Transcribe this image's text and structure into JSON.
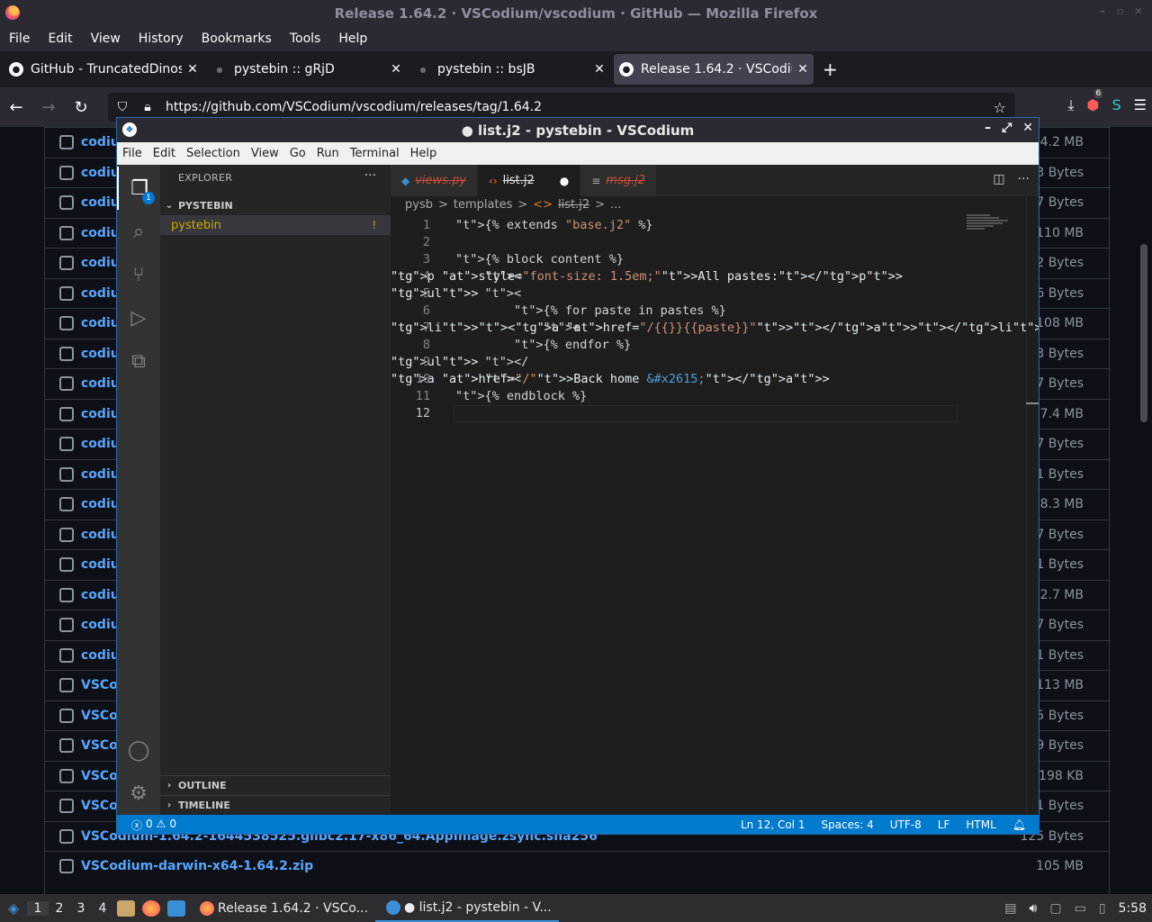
{
  "firefox": {
    "title": "Release 1.64.2 · VSCodium/vscodium · GitHub — Mozilla Firefox",
    "menu": [
      "File",
      "Edit",
      "View",
      "History",
      "Bookmarks",
      "Tools",
      "Help"
    ],
    "tabs": [
      {
        "label": "GitHub - TruncatedDinos",
        "icon": "github-icon"
      },
      {
        "label": "pystebin :: gRjD",
        "icon": "dot-icon"
      },
      {
        "label": "pystebin :: bsJB",
        "icon": "dot-icon"
      },
      {
        "label": "Release 1.64.2 · VSCodiu",
        "icon": "github-icon"
      }
    ],
    "url": "https://github.com/VSCodium/vscodium/releases/tag/1.64.2",
    "extension_badge": "6"
  },
  "assets": [
    {
      "name": "codiu",
      "size": "4.2 MB"
    },
    {
      "name": "codiu",
      "size": "3 Bytes"
    },
    {
      "name": "codiu",
      "size": "7 Bytes"
    },
    {
      "name": "codiu",
      "size": "110 MB"
    },
    {
      "name": "codiu",
      "size": "2 Bytes"
    },
    {
      "name": "codiu",
      "size": "6 Bytes"
    },
    {
      "name": "codiu",
      "size": "108 MB"
    },
    {
      "name": "codiu",
      "size": "3 Bytes"
    },
    {
      "name": "codiu",
      "size": "7 Bytes"
    },
    {
      "name": "codiu",
      "size": "7.4 MB"
    },
    {
      "name": "codiu",
      "size": "7 Bytes"
    },
    {
      "name": "codiu",
      "size": "1 Bytes"
    },
    {
      "name": "codiu",
      "size": "8.3 MB"
    },
    {
      "name": "codiu",
      "size": "7 Bytes"
    },
    {
      "name": "codiu",
      "size": "1 Bytes"
    },
    {
      "name": "codiu",
      "size": "2.7 MB"
    },
    {
      "name": "codiu",
      "size": "7 Bytes"
    },
    {
      "name": "codiu",
      "size": "1 Bytes"
    },
    {
      "name": "VSCo",
      "size": "113 MB"
    },
    {
      "name": "VSCo",
      "size": "5 Bytes"
    },
    {
      "name": "VSCo",
      "size": "9 Bytes"
    },
    {
      "name": "VSCo",
      "size": "198 KB"
    },
    {
      "name": "VSCo",
      "size": "1 Bytes"
    },
    {
      "name": "VSCodium-1.64.2-1644538525.glibc2.17-x86_64.AppImage.zsync.sha256",
      "size": "125 Bytes"
    },
    {
      "name": "VSCodium-darwin-x64-1.64.2.zip",
      "size": "105 MB"
    }
  ],
  "vscodium": {
    "title": "● list.j2 - pystebin - VSCodium",
    "menu": [
      "File",
      "Edit",
      "Selection",
      "View",
      "Go",
      "Run",
      "Terminal",
      "Help"
    ],
    "explorer_label": "EXPLORER",
    "explorer_badge": "1",
    "workspace": "PYSTEBIN",
    "folder": "pystebin",
    "folder_marker": "!",
    "outline_label": "OUTLINE",
    "timeline_label": "TIMELINE",
    "editor_tabs": [
      {
        "name": "views.py",
        "icon": "python-file-icon"
      },
      {
        "name": "list.j2",
        "icon": "code-file-icon",
        "dirty": "●"
      },
      {
        "name": "msg.j2",
        "icon": "text-file-icon"
      }
    ],
    "breadcrumb": [
      "pysb",
      ">",
      "templates",
      ">",
      "<>",
      "list.j2",
      ">",
      "..."
    ],
    "code_lines": [
      {
        "n": "1",
        "text": "{% extends \"base.j2\" %}"
      },
      {
        "n": "2",
        "text": ""
      },
      {
        "n": "3",
        "text": "{% block content %}"
      },
      {
        "n": "4",
        "text": "    <p style=\"font-size: 1.5em;\">All pastes:</p>"
      },
      {
        "n": "5",
        "text": "    <ul>"
      },
      {
        "n": "6",
        "text": "        {% for paste in pastes %}"
      },
      {
        "n": "7",
        "text": "            <li><a href=\"/{{}}{{paste}}\"></a></li>"
      },
      {
        "n": "8",
        "text": "        {% endfor %}"
      },
      {
        "n": "9",
        "text": "    </ul>"
      },
      {
        "n": "10",
        "text": "    <a href=\"/\">Back home &#x2615;</a>"
      },
      {
        "n": "11",
        "text": "{% endblock %}"
      },
      {
        "n": "12",
        "text": ""
      }
    ],
    "status": {
      "errors": "0",
      "warnings": "0",
      "position": "Ln 12, Col 1",
      "spaces": "Spaces: 4",
      "encoding": "UTF-8",
      "eol": "LF",
      "language": "HTML"
    }
  },
  "taskbar": {
    "workspaces": [
      "1",
      "2",
      "3",
      "4"
    ],
    "tasks": [
      {
        "label": "Release 1.64.2 · VSCo..."
      },
      {
        "label": "● list.j2 - pystebin - V..."
      }
    ],
    "clock": "5:58"
  }
}
